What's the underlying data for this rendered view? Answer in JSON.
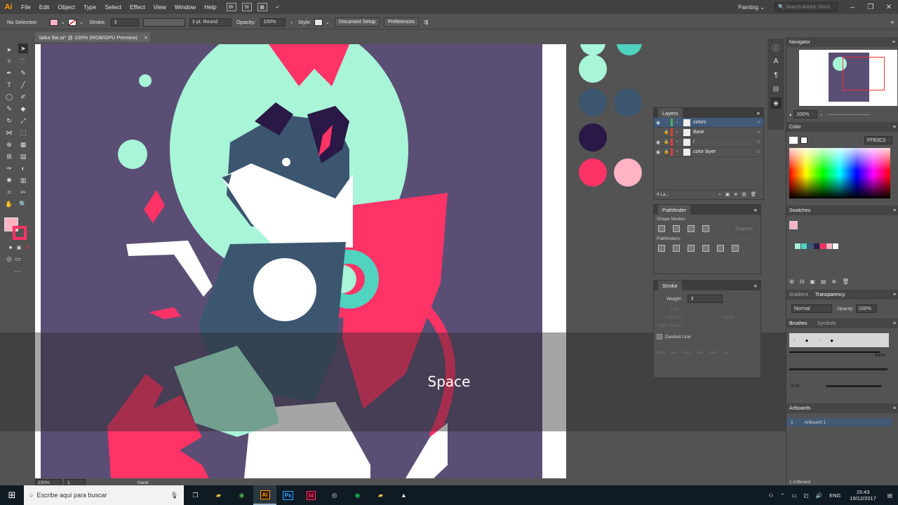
{
  "app": {
    "logo": "Ai",
    "menus": [
      "File",
      "Edit",
      "Object",
      "Type",
      "Select",
      "Effect",
      "View",
      "Window",
      "Help"
    ],
    "bridge_label": "Br",
    "stock_label": "St",
    "workspace": "Painting",
    "stock_search_placeholder": "Search Adobe Stock"
  },
  "control_bar": {
    "selection": "No Selection",
    "stroke_label": "Stroke:",
    "brush": "3 pt. Round",
    "opacity_label": "Opacity:",
    "opacity_value": "100%",
    "style_label": "Style:",
    "document_setup": "Document Setup",
    "preferences": "Preferences"
  },
  "document": {
    "tab_title": "laika flat.ai* @ 100% (RGB/GPU Preview)",
    "close_glyph": "×"
  },
  "overlay": {
    "caption": "Space"
  },
  "layers_panel": {
    "title": "Layers",
    "layers": [
      {
        "name": "colors",
        "color": "#4fb35a",
        "selected": true
      },
      {
        "name": "Base",
        "color": "#e23d3d",
        "selected": false
      },
      {
        "name": "/",
        "color": "#e23d3d",
        "selected": false
      },
      {
        "name": "color layer",
        "color": "#e23d3d",
        "selected": false
      }
    ],
    "footer": "4 La..."
  },
  "pathfinder_panel": {
    "title": "Pathfinder",
    "shape_modes": "Shape Modes:",
    "expand": "Expand",
    "pathfinders": "Pathfinders:"
  },
  "stroke_panel": {
    "title": "Stroke",
    "weight_label": "Weight:",
    "cap_label": "Cap:",
    "corner_label": "Corner:",
    "limit_label": "Limit:",
    "align_label": "Align Stroke:",
    "dashed_line": "Dashed Line",
    "dash_labels": [
      "dash",
      "gap",
      "dash",
      "gap",
      "dash",
      "gap"
    ]
  },
  "dock": {
    "navigator_title": "Navigator",
    "zoom": "100%",
    "color_title": "Color",
    "hex": "FFB3C3",
    "swatches_title": "Swatches",
    "swatch_colors": [
      "#a8f0d6",
      "#4fd3c0",
      "#3a5a74",
      "#2a1a4a",
      "#ff3060",
      "#ffb3c3",
      "#ffffff"
    ],
    "gradient_tab": "Gradient",
    "transparency_tab": "Transparency",
    "blend_mode": "Normal",
    "opacity_label": "Opacity:",
    "opacity_value": "100%",
    "brushes_tab": "Brushes",
    "symbols_tab": "Symbols",
    "basic_label": "Basic",
    "brush_size": "3,00",
    "artboards_title": "Artboards",
    "artboard_number": "1",
    "artboard_name": "Artboard 1",
    "artboard_footer": "1 Artboard"
  },
  "status_bar": {
    "zoom": "100%",
    "page": "1",
    "tool": "Hand"
  },
  "taskbar": {
    "search_placeholder": "Escribe aquí para buscar",
    "apps": [
      {
        "label": "Ai",
        "color": "#ff9a00",
        "bg": "#2b1a00",
        "active": true
      },
      {
        "label": "Ps",
        "color": "#31a8ff",
        "bg": "#001e36",
        "active": false
      },
      {
        "label": "Id",
        "color": "#ff3366",
        "bg": "#49021f",
        "active": false
      }
    ],
    "language": "ENG",
    "time": "15:43",
    "date": "19/12/2017"
  },
  "artwork_colors": {
    "background": "#5b4e75",
    "mint": "#a8f5d8",
    "teal": "#50d3bf",
    "navy": "#3c5670",
    "red": "#ff3366",
    "purple": "#2a1846",
    "pink": "#ffb3c3",
    "white": "#ffffff"
  }
}
